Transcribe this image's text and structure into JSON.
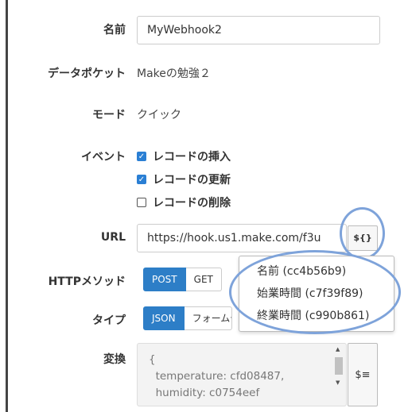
{
  "fields": {
    "name_label": "名前",
    "name_value": "MyWebhook2",
    "datastore_label": "データポケット",
    "datastore_value": "Makeの勉強２",
    "mode_label": "モード",
    "mode_value": "クイック",
    "event_label": "イベント",
    "url_label": "URL",
    "url_value": "https://hook.us1.make.com/f3u",
    "http_label": "HTTPメソッド",
    "type_label": "タイプ",
    "transform_label": "変換"
  },
  "events": [
    {
      "label": "レコードの挿入",
      "checked": true
    },
    {
      "label": "レコードの更新",
      "checked": true
    },
    {
      "label": "レコードの削除",
      "checked": false
    }
  ],
  "variable_button": "${}",
  "http_methods": [
    "POST",
    "GET"
  ],
  "http_selected": "POST",
  "types": [
    "JSON",
    "フォームデ"
  ],
  "type_selected": "JSON",
  "dropdown_items": [
    "名前 (cc4b56b9)",
    "始業時間 (c7f39f89)",
    "終業時間 (c990b861)"
  ],
  "transform_lines": [
    "{",
    "  temperature: cfd08487,",
    "  humidity: c0754eef"
  ],
  "transform_tool_icon": "$≡",
  "colors": {
    "accent": "#2d7ec7",
    "highlight_circle": "#7ea3da"
  }
}
